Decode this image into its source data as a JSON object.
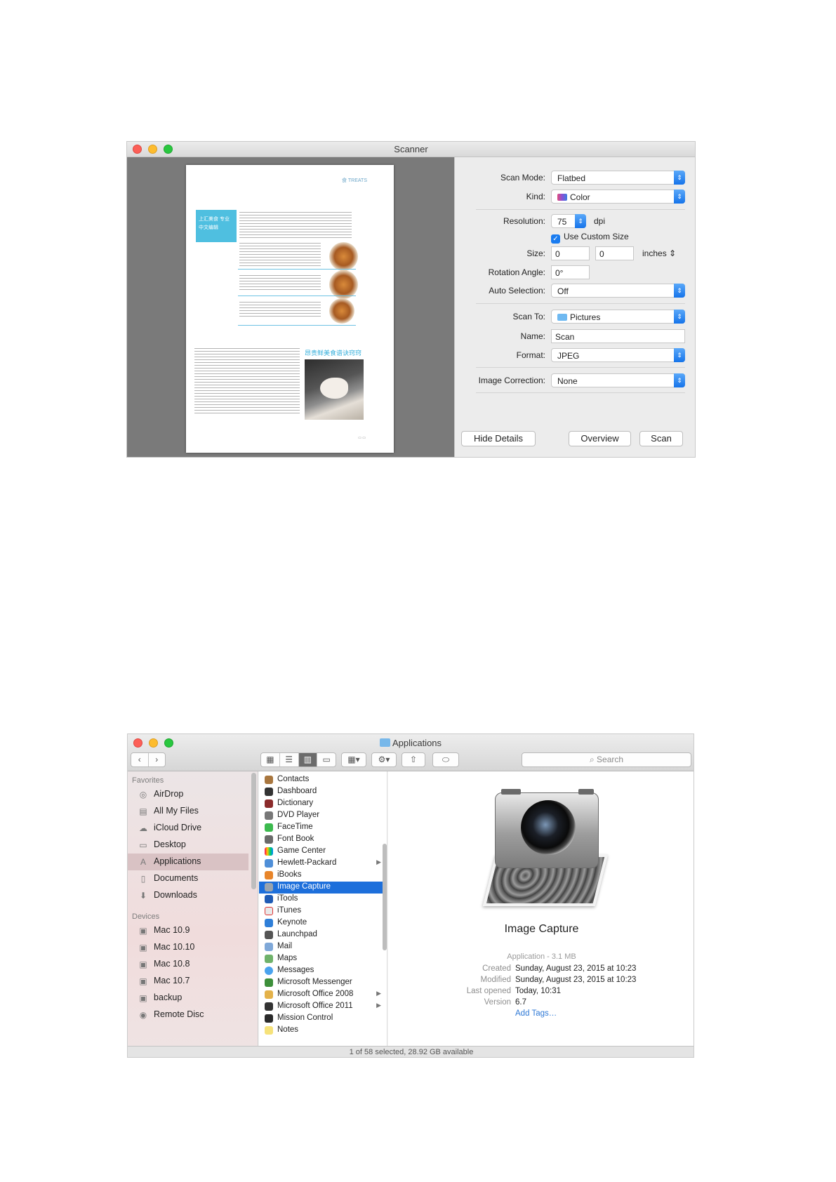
{
  "scanner": {
    "title": "Scanner",
    "preview": {
      "header_text": "食 TREATS",
      "box_text": "上汇美食 专业中文编辑",
      "subheading": "昂贵鲜美食谱诀窍窍"
    },
    "fields": {
      "scan_mode": {
        "label": "Scan Mode:",
        "value": "Flatbed"
      },
      "kind": {
        "label": "Kind:",
        "value": "Color"
      },
      "resolution": {
        "label": "Resolution:",
        "value": "75",
        "unit": "dpi"
      },
      "custom_size": {
        "label": "Use Custom Size",
        "checked": true
      },
      "size": {
        "label": "Size:",
        "width": "0",
        "height": "0",
        "unit": "inches"
      },
      "rotation": {
        "label": "Rotation Angle:",
        "value": "0°"
      },
      "auto_selection": {
        "label": "Auto Selection:",
        "value": "Off"
      },
      "scan_to": {
        "label": "Scan To:",
        "value": "Pictures"
      },
      "name": {
        "label": "Name:",
        "value": "Scan"
      },
      "format": {
        "label": "Format:",
        "value": "JPEG"
      },
      "image_correction": {
        "label": "Image Correction:",
        "value": "None"
      }
    },
    "buttons": {
      "hide_details": "Hide Details",
      "overview": "Overview",
      "scan": "Scan"
    }
  },
  "finder": {
    "title": "Applications",
    "search_placeholder": "Search",
    "toolbar": {
      "back": "‹",
      "forward": "›",
      "share": "⇧",
      "action": "⚙"
    },
    "sidebar": {
      "favorites_header": "Favorites",
      "favorites": [
        "AirDrop",
        "All My Files",
        "iCloud Drive",
        "Desktop",
        "Applications",
        "Documents",
        "Downloads"
      ],
      "devices_header": "Devices",
      "devices": [
        "Mac 10.9",
        "Mac 10.10",
        "Mac 10.8",
        "Mac 10.7",
        "backup",
        "Remote Disc"
      ]
    },
    "apps": [
      "Contacts",
      "Dashboard",
      "Dictionary",
      "DVD Player",
      "FaceTime",
      "Font Book",
      "Game Center",
      "Hewlett-Packard",
      "iBooks",
      "Image Capture",
      "iTools",
      "iTunes",
      "Keynote",
      "Launchpad",
      "Mail",
      "Maps",
      "Messages",
      "Microsoft Messenger",
      "Microsoft Office 2008",
      "Microsoft Office 2011",
      "Mission Control",
      "Notes"
    ],
    "selected_app": "Image Capture",
    "detail": {
      "name": "Image Capture",
      "kind": "Application - 3.1 MB",
      "created_label": "Created",
      "created": "Sunday, August 23, 2015 at 10:23",
      "modified_label": "Modified",
      "modified": "Sunday, August 23, 2015 at 10:23",
      "last_opened_label": "Last opened",
      "last_opened": "Today, 10:31",
      "version_label": "Version",
      "version": "6.7",
      "add_tags": "Add Tags…"
    },
    "status": "1 of 58 selected, 28.92 GB available"
  },
  "colors": {
    "accent": "#1d6fdb",
    "sidebar_selected": "#d9c2c4",
    "preview_bg": "#7a7a7a"
  }
}
